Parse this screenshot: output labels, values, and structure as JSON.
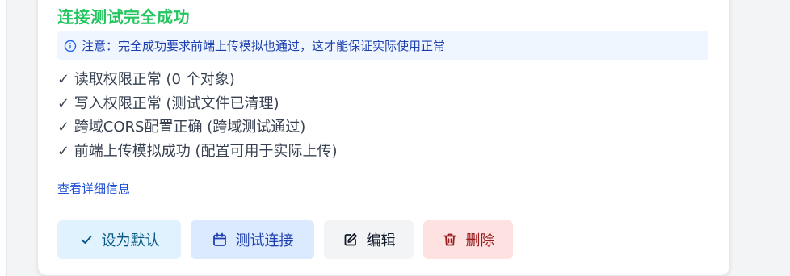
{
  "card": {
    "title": "连接测试完全成功",
    "notice": "注意：完全成功要求前端上传模拟也通过，这才能保证实际使用正常",
    "checks": [
      "✓ 读取权限正常 (0 个对象)",
      "✓ 写入权限正常 (测试文件已清理)",
      "✓ 跨域CORS配置正确 (跨域测试通过)",
      "✓ 前端上传模拟成功 (配置可用于实际上传)"
    ],
    "details_link": "查看详细信息"
  },
  "actions": {
    "set_default": "设为默认",
    "test_connection": "测试连接",
    "edit": "编辑",
    "delete": "删除"
  },
  "colors": {
    "success": "#22c55e",
    "info_bg": "#eff6ff",
    "info_text": "#1e40af",
    "link": "#1d4ed8",
    "danger_bg": "#fee2e2",
    "danger_text": "#991b1b"
  },
  "icons": {
    "notice": "info-circle-icon",
    "set_default": "check-icon",
    "test_connection": "calendar-icon",
    "edit": "edit-icon",
    "delete": "trash-icon"
  }
}
